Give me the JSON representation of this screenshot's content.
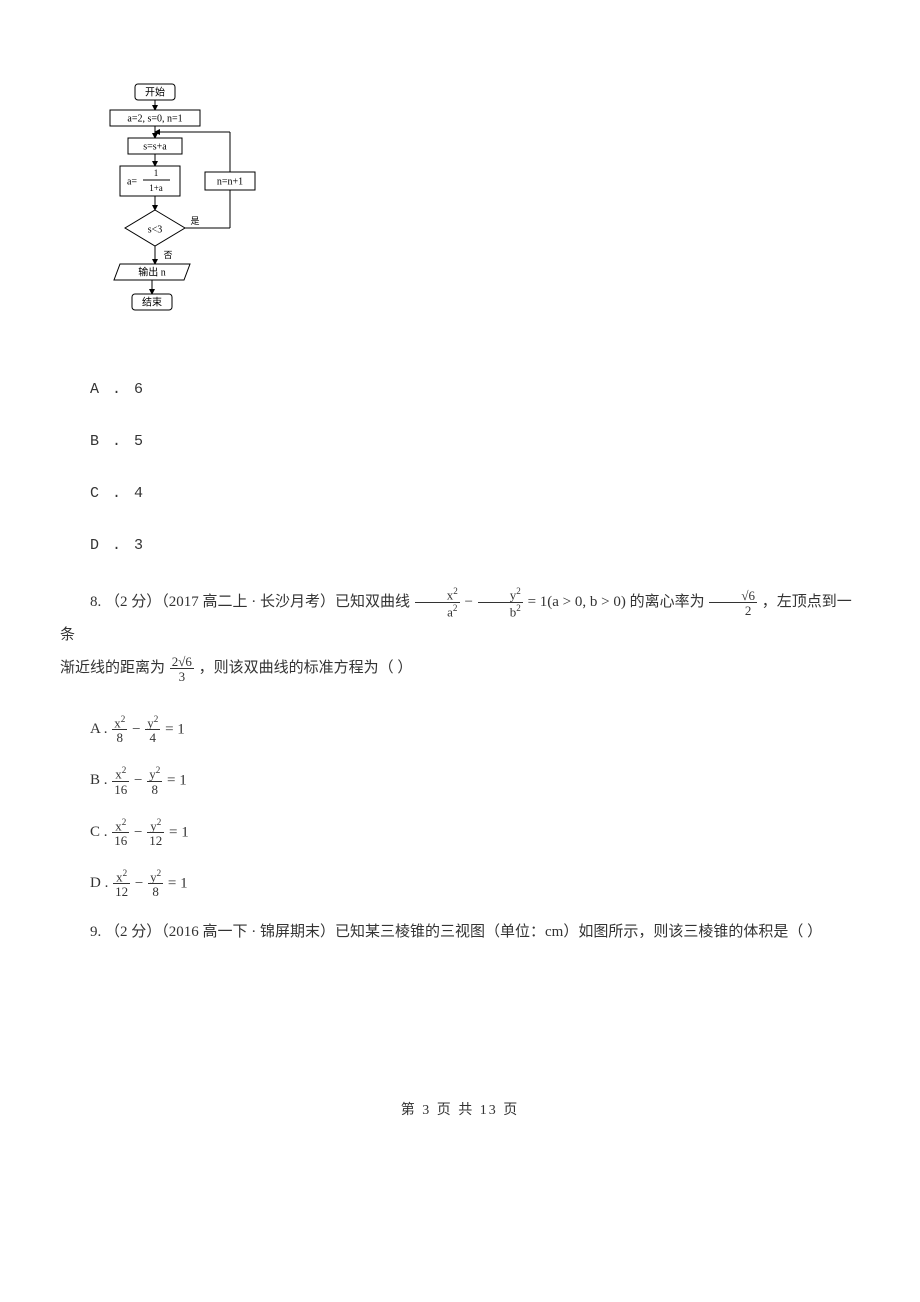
{
  "flowchart": {
    "start": "开始",
    "init": "a=2, s=0, n=1",
    "step1": "s=s+a",
    "step2_num": "1",
    "step2_den": "1+a",
    "step2_lhs": "a=",
    "inc": "n=n+1",
    "cond": "s<3",
    "yes": "是",
    "no": "否",
    "output": "输出 n",
    "end": "结束"
  },
  "q7_options": {
    "A": "A . 6",
    "B": "B . 5",
    "C": "C . 4",
    "D": "D . 3"
  },
  "q8": {
    "prefix": "8. （2 分）（2017 高二上 · 长沙月考）已知双曲线 ",
    "f1a": "x",
    "f1b": "a",
    "f1c": "y",
    "f1d": "b",
    "cond": " = 1(a > 0, b > 0)",
    "mid1": " 的离心率为 ",
    "e_num": "√6",
    "e_den": "2",
    "mid2": " ，左顶点到一条",
    "line2a": "渐近线的距离为 ",
    "d_num": "2√6",
    "d_den": "3",
    "line2b": " ，则该双曲线的标准方程为（    ）",
    "options": [
      {
        "label": "A . ",
        "xn": "x",
        "xd": "8",
        "yn": "y",
        "yd": "4"
      },
      {
        "label": "B . ",
        "xn": "x",
        "xd": "16",
        "yn": "y",
        "yd": "8"
      },
      {
        "label": "C . ",
        "xn": "x",
        "xd": "16",
        "yn": "y",
        "yd": "12"
      },
      {
        "label": "D . ",
        "xn": "x",
        "xd": "12",
        "yn": "y",
        "yd": "8"
      }
    ]
  },
  "q9": {
    "text": "9. （2 分）（2016 高一下 · 锦屏期末）已知某三棱锥的三视图（单位：cm）如图所示，则该三棱锥的体积是（     ）"
  },
  "footer": "第 3 页 共 13 页"
}
